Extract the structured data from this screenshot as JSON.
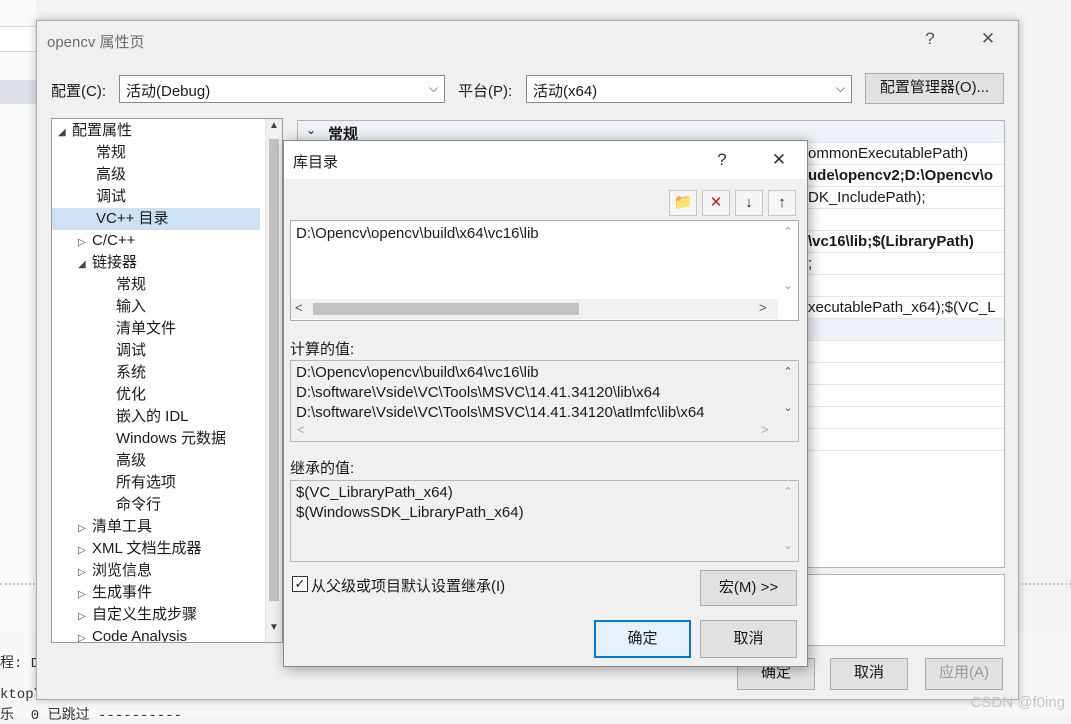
{
  "background": {
    "output_line1": "程: De",
    "output_line2": "ktop\\",
    "output_line3": "乐  0 已跳过 ----------"
  },
  "property_window": {
    "title": "opencv 属性页",
    "help": "?",
    "close": "✕",
    "config_label": "配置(C):",
    "config_value": "活动(Debug)",
    "platform_label": "平台(P):",
    "platform_value": "活动(x64)",
    "config_manager": "配置管理器(O)...",
    "ok": "确定",
    "cancel": "取消",
    "apply": "应用(A)"
  },
  "tree": {
    "items": [
      {
        "label": "配置属性",
        "exp": "◢"
      },
      {
        "label": "常规"
      },
      {
        "label": "高级"
      },
      {
        "label": "调试"
      },
      {
        "label": "VC++ 目录"
      },
      {
        "label": "C/C++",
        "exp": "▷"
      },
      {
        "label": "链接器",
        "exp": "◢"
      },
      {
        "label": "常规"
      },
      {
        "label": "输入"
      },
      {
        "label": "清单文件"
      },
      {
        "label": "调试"
      },
      {
        "label": "系统"
      },
      {
        "label": "优化"
      },
      {
        "label": "嵌入的 IDL"
      },
      {
        "label": "Windows 元数据"
      },
      {
        "label": "高级"
      },
      {
        "label": "所有选项"
      },
      {
        "label": "命令行"
      },
      {
        "label": "清单工具",
        "exp": "▷"
      },
      {
        "label": "XML 文档生成器",
        "exp": "▷"
      },
      {
        "label": "浏览信息",
        "exp": "▷"
      },
      {
        "label": "生成事件",
        "exp": "▷"
      },
      {
        "label": "自定义生成步骤",
        "exp": "▷"
      },
      {
        "label": "Code Analysis",
        "exp": "▷"
      }
    ]
  },
  "grid": {
    "section": "常规",
    "section_exp": "⌄",
    "row1": "ommonExecutablePath)",
    "row2": "ude\\opencv2;D:\\Opencv\\o",
    "row3": "DK_IncludePath);",
    "row4": "\\vc16\\lib;$(LibraryPath)",
    "row5": ";",
    "row6": "xecutablePath_x64);$(VC_L"
  },
  "lib_dialog": {
    "title": "库目录",
    "help": "?",
    "close": "✕",
    "toolbar": {
      "new": "📁",
      "delete": "✕",
      "down": "↓",
      "up": "↑"
    },
    "edit_value": "D:\\Opencv\\opencv\\build\\x64\\vc16\\lib",
    "computed_label": "计算的值:",
    "computed_values": [
      "D:\\Opencv\\opencv\\build\\x64\\vc16\\lib",
      "D:\\software\\Vside\\VC\\Tools\\MSVC\\14.41.34120\\lib\\x64",
      "D:\\software\\Vside\\VC\\Tools\\MSVC\\14.41.34120\\atlmfc\\lib\\x64"
    ],
    "inherited_label": "继承的值:",
    "inherited_values": [
      "$(VC_LibraryPath_x64)",
      "$(WindowsSDK_LibraryPath_x64)"
    ],
    "inherit_checkbox": "从父级或项目默认设置继承(I)",
    "inherit_checked": "✓",
    "macro_button": "宏(M) >>",
    "ok": "确定",
    "cancel": "取消"
  },
  "watermark": "CSDN @f0ing"
}
